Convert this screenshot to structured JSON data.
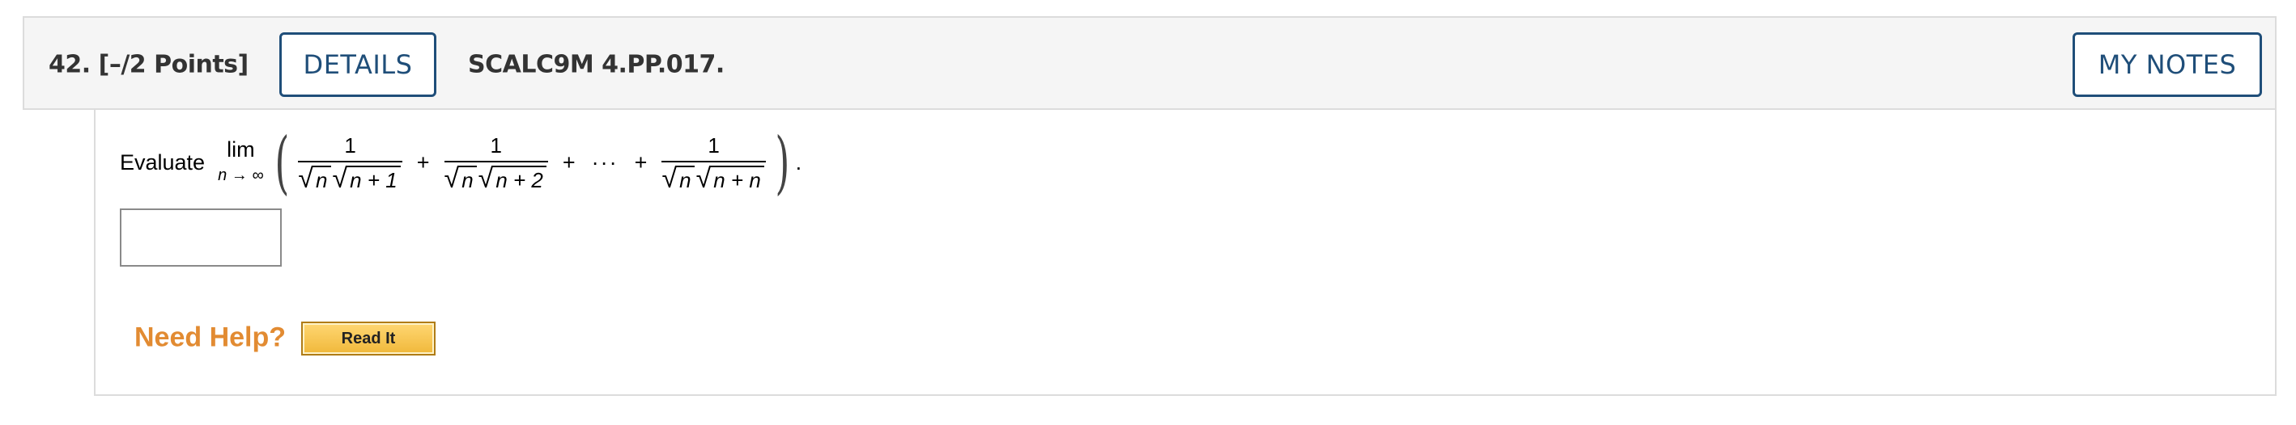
{
  "question": {
    "number_label": "42.",
    "points_label": "[–/2 Points]",
    "details_button": "DETAILS",
    "code": "SCALC9M 4.PP.017.",
    "my_notes_button": "MY NOTES"
  },
  "problem": {
    "prompt": "Evaluate",
    "lim_operator": "lim",
    "lim_subscript": "n → ∞",
    "open_paren": "(",
    "close_paren": ")",
    "terms": [
      {
        "numerator": "1",
        "sqrt1": "n",
        "sqrt2": "n + 1"
      },
      {
        "numerator": "1",
        "sqrt1": "n",
        "sqrt2": "n + 2"
      },
      {
        "numerator": "1",
        "sqrt1": "n",
        "sqrt2": "n + n"
      }
    ],
    "plus": "+",
    "ellipsis": "···",
    "period": ".",
    "radical": "√"
  },
  "answer": {
    "value": ""
  },
  "help": {
    "label": "Need Help?",
    "read_it_button": "Read It"
  },
  "colors": {
    "button_border": "#1f4e79",
    "need_help": "#e28b32",
    "read_it_bg": "#f0b83a"
  }
}
